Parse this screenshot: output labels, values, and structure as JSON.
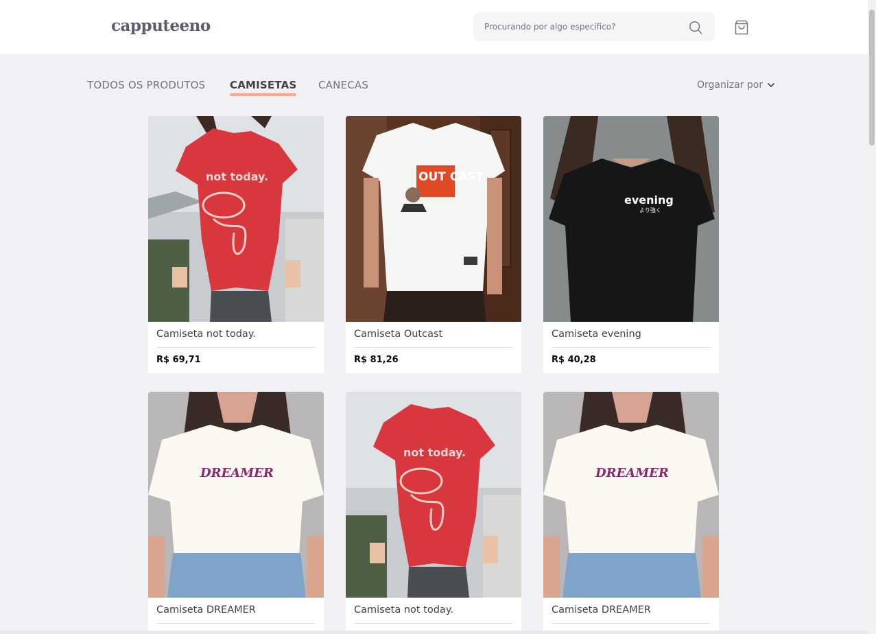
{
  "header": {
    "logo": "capputeeno",
    "search_placeholder": "Procurando por algo específico?"
  },
  "tabs": [
    {
      "label": "TODOS OS PRODUTOS",
      "active": false
    },
    {
      "label": "CAMISETAS",
      "active": true
    },
    {
      "label": "CANECAS",
      "active": false
    }
  ],
  "sort": {
    "label": "Organizar por"
  },
  "products": [
    {
      "name": "Camiseta not today.",
      "price": "R$ 69,71",
      "image": "red-tshirt-not-today"
    },
    {
      "name": "Camiseta Outcast",
      "price": "R$ 81,26",
      "image": "white-tshirt-outcast"
    },
    {
      "name": "Camiseta evening",
      "price": "R$ 40,28",
      "image": "black-tshirt-evening"
    },
    {
      "name": "Camiseta DREAMER",
      "price": "",
      "image": "cream-tshirt-dreamer"
    },
    {
      "name": "Camiseta not today.",
      "price": "",
      "image": "red-tshirt-not-today"
    },
    {
      "name": "Camiseta DREAMER",
      "price": "",
      "image": "cream-tshirt-dreamer"
    }
  ],
  "image_prints": {
    "not_today": "not today.",
    "outcast": "OUT CAST",
    "evening": "evening",
    "evening_sub": "より強く",
    "dreamer": "DREAMER"
  },
  "colors": {
    "accent": "#ffa585",
    "background": "#f0f0f5",
    "text": "#41414d",
    "muted": "#737380"
  }
}
